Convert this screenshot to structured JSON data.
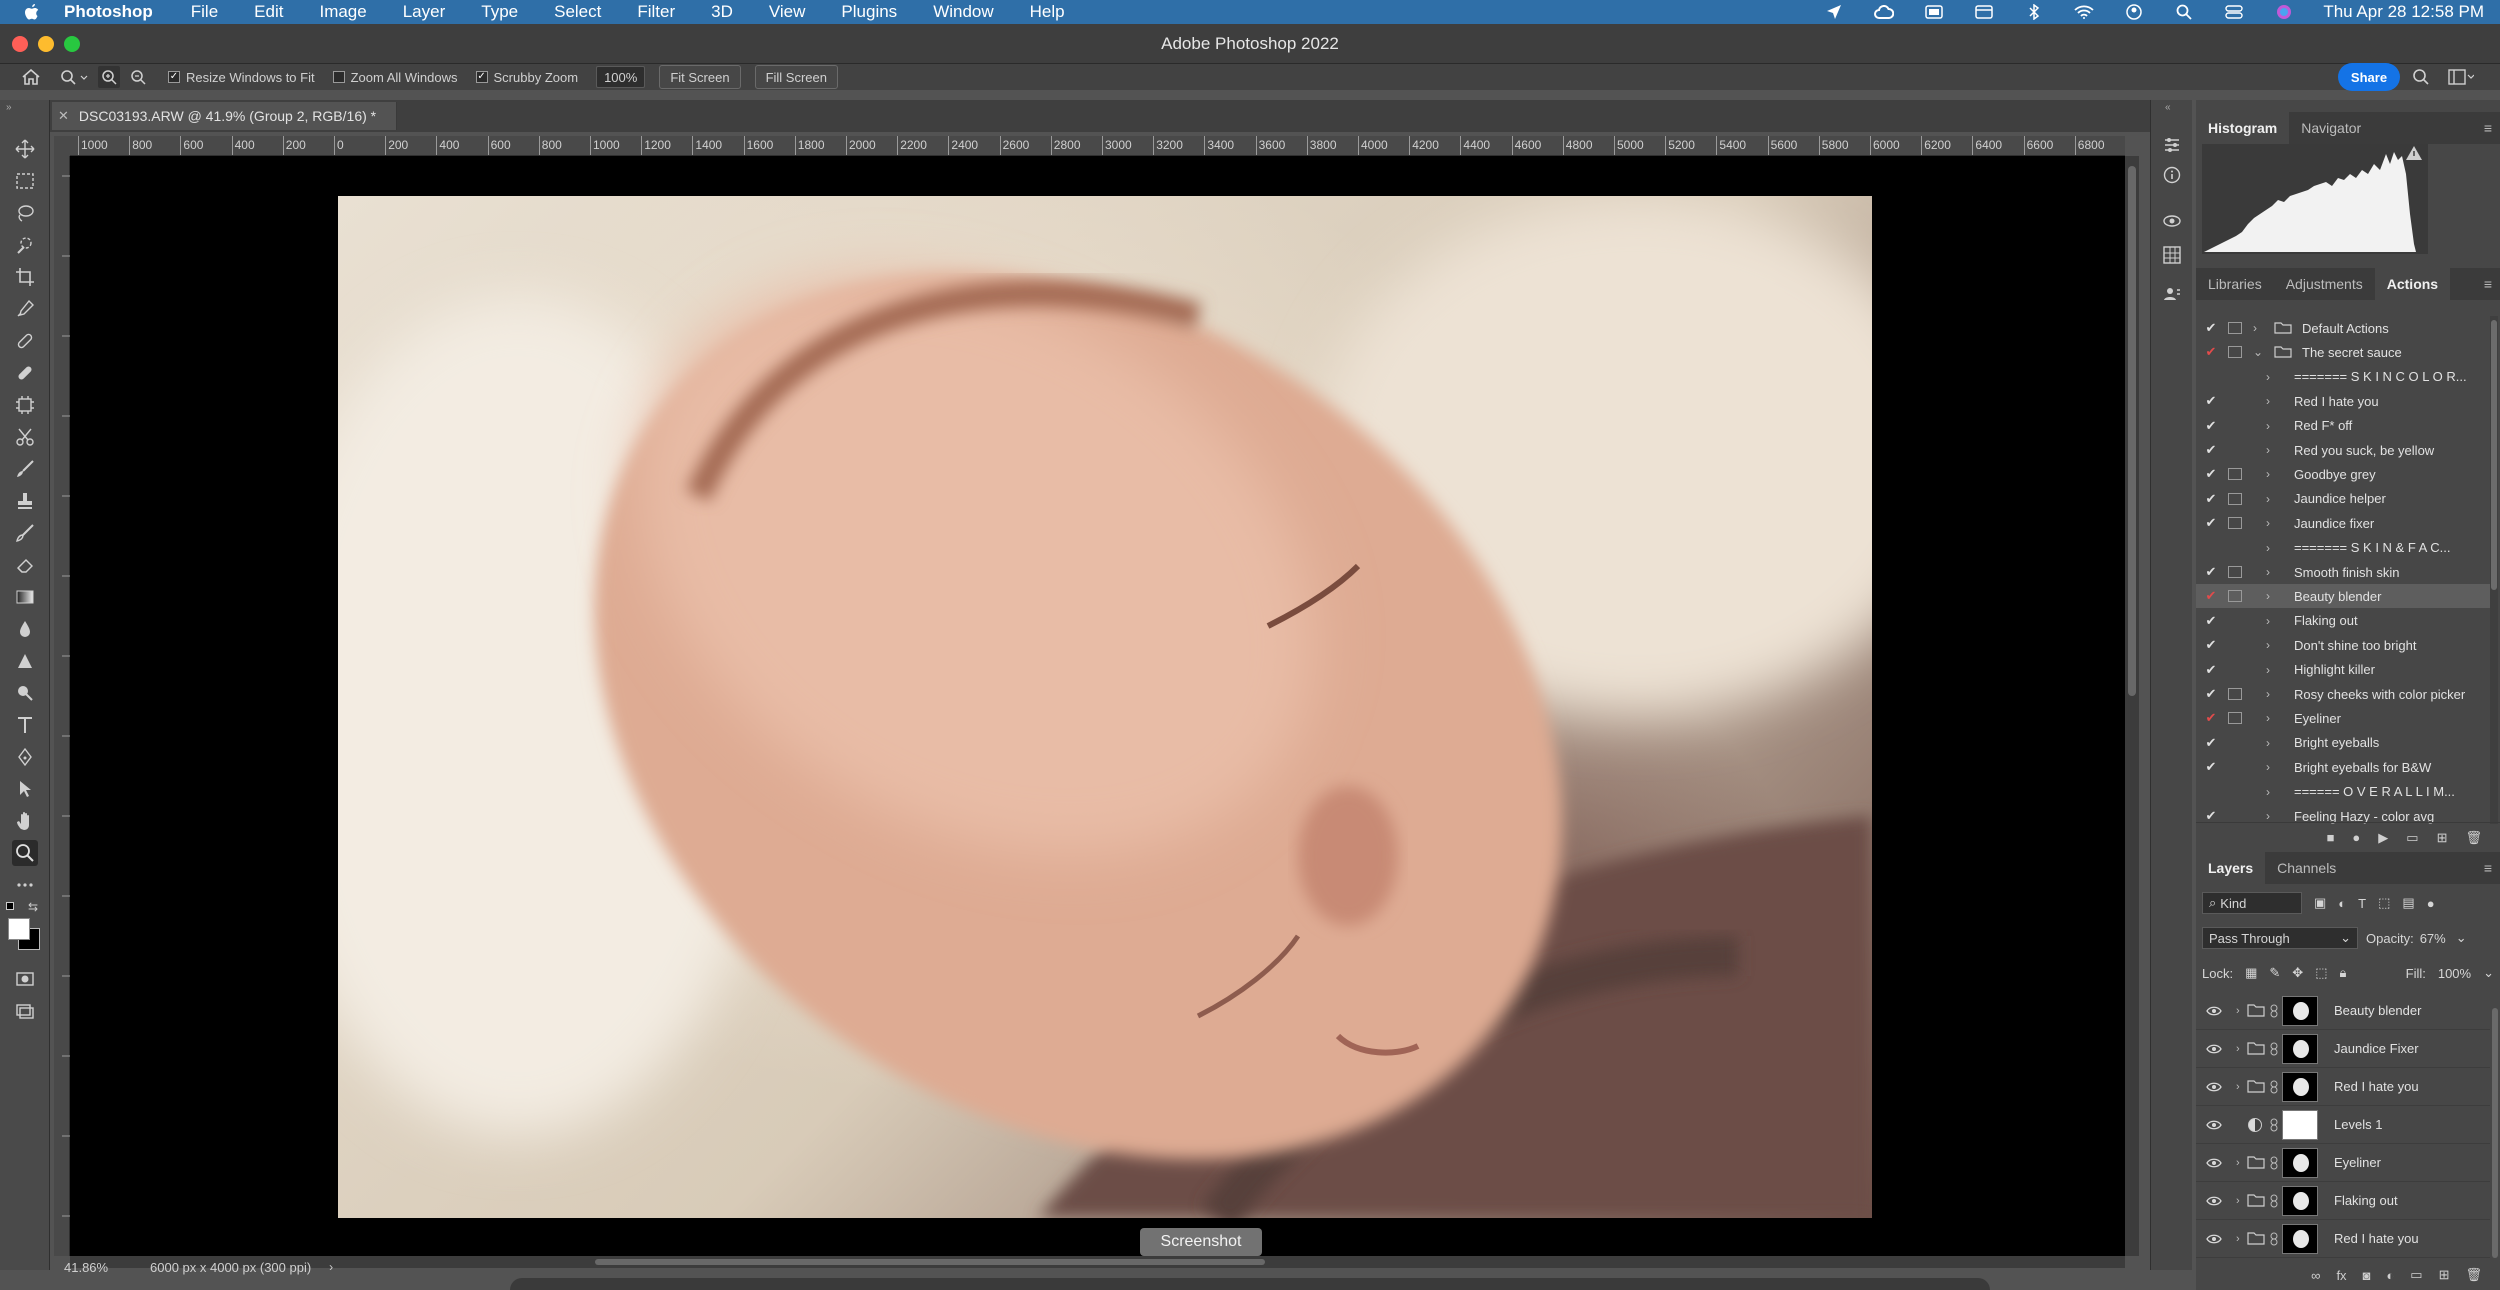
{
  "menubar": {
    "app": "Photoshop",
    "items": [
      "File",
      "Edit",
      "Image",
      "Layer",
      "Type",
      "Select",
      "Filter",
      "3D",
      "View",
      "Plugins",
      "Window",
      "Help"
    ],
    "clock": "Thu Apr 28  12:58 PM"
  },
  "window": {
    "title": "Adobe Photoshop 2022"
  },
  "options": {
    "resize_windows": "Resize Windows to Fit",
    "zoom_all": "Zoom All Windows",
    "scrubby": "Scrubby Zoom",
    "zoom_value": "100%",
    "fit_screen": "Fit Screen",
    "fill_screen": "Fill Screen",
    "share": "Share"
  },
  "document": {
    "tab": "DSC03193.ARW @ 41.9% (Group 2, RGB/16) *",
    "zoom": "41.86%",
    "info": "6000 px x 4000 px (300 ppi)"
  },
  "ruler": {
    "labels": [
      "1000",
      "800",
      "600",
      "400",
      "200",
      "0",
      "200",
      "400",
      "600",
      "800",
      "1000",
      "1200",
      "1400",
      "1600",
      "1800",
      "2000",
      "2200",
      "2400",
      "2600",
      "2800",
      "3000",
      "3200",
      "3400",
      "3600",
      "3800",
      "4000",
      "4200",
      "4400",
      "4600",
      "4800",
      "5000",
      "5200",
      "5400",
      "5600",
      "5800",
      "6000",
      "6200",
      "6400",
      "6600",
      "6800"
    ]
  },
  "tooltip": "Screenshot",
  "panels": {
    "top_tabs": [
      "Histogram",
      "Navigator"
    ],
    "mid_tabs": [
      "Libraries",
      "Adjustments",
      "Actions"
    ],
    "layer_tabs": [
      "Layers",
      "Channels"
    ]
  },
  "actions": [
    {
      "label": "Default Actions",
      "check": "✔",
      "red": false,
      "dialog": true,
      "twisty": "›",
      "folder": true
    },
    {
      "label": "The secret sauce",
      "check": "✔",
      "red": true,
      "dialog": true,
      "twisty": "⌄",
      "folder": true
    },
    {
      "label": "======= S K I N  C O L O R...",
      "check": "",
      "red": false,
      "dialog": false,
      "twisty": "›",
      "folder": false
    },
    {
      "label": "Red I hate you",
      "check": "✔",
      "red": false,
      "dialog": false,
      "twisty": "›",
      "folder": false
    },
    {
      "label": "Red F* off",
      "check": "✔",
      "red": false,
      "dialog": false,
      "twisty": "›",
      "folder": false
    },
    {
      "label": "Red you suck, be yellow",
      "check": "✔",
      "red": false,
      "dialog": false,
      "twisty": "›",
      "folder": false
    },
    {
      "label": "Goodbye grey",
      "check": "✔",
      "red": false,
      "dialog": true,
      "twisty": "›",
      "folder": false
    },
    {
      "label": "Jaundice helper",
      "check": "✔",
      "red": false,
      "dialog": true,
      "twisty": "›",
      "folder": false
    },
    {
      "label": "Jaundice fixer",
      "check": "✔",
      "red": false,
      "dialog": true,
      "twisty": "›",
      "folder": false
    },
    {
      "label": "======= S K I N  &  F A C...",
      "check": "",
      "red": false,
      "dialog": false,
      "twisty": "›",
      "folder": false
    },
    {
      "label": "Smooth finish skin",
      "check": "✔",
      "red": false,
      "dialog": true,
      "twisty": "›",
      "folder": false
    },
    {
      "label": "Beauty blender",
      "check": "✔",
      "red": true,
      "dialog": true,
      "twisty": "›",
      "folder": false,
      "selected": true
    },
    {
      "label": "Flaking out",
      "check": "✔",
      "red": false,
      "dialog": false,
      "twisty": "›",
      "folder": false
    },
    {
      "label": "Don't shine too bright",
      "check": "✔",
      "red": false,
      "dialog": false,
      "twisty": "›",
      "folder": false
    },
    {
      "label": "Highlight killer",
      "check": "✔",
      "red": false,
      "dialog": false,
      "twisty": "›",
      "folder": false
    },
    {
      "label": "Rosy cheeks with color picker",
      "check": "✔",
      "red": false,
      "dialog": true,
      "twisty": "›",
      "folder": false
    },
    {
      "label": "Eyeliner",
      "check": "✔",
      "red": true,
      "dialog": true,
      "twisty": "›",
      "folder": false
    },
    {
      "label": "Bright eyeballs",
      "check": "✔",
      "red": false,
      "dialog": false,
      "twisty": "›",
      "folder": false
    },
    {
      "label": "Bright eyeballs for B&W",
      "check": "✔",
      "red": false,
      "dialog": false,
      "twisty": "›",
      "folder": false
    },
    {
      "label": "====== O V E R A L L  I M...",
      "check": "",
      "red": false,
      "dialog": false,
      "twisty": "›",
      "folder": false
    },
    {
      "label": "Feeling Hazy - color avg",
      "check": "✔",
      "red": false,
      "dialog": false,
      "twisty": "›",
      "folder": false
    }
  ],
  "layers_controls": {
    "kind": "Kind",
    "blend_mode": "Pass Through",
    "opacity_label": "Opacity:",
    "opacity_value": "67%",
    "lock_label": "Lock:",
    "fill_label": "Fill:",
    "fill_value": "100%"
  },
  "layers": [
    {
      "name": "Beauty blender",
      "type": "group"
    },
    {
      "name": "Jaundice Fixer",
      "type": "group"
    },
    {
      "name": "Red I hate you",
      "type": "group"
    },
    {
      "name": "Levels 1",
      "type": "adjustment"
    },
    {
      "name": "Eyeliner",
      "type": "group"
    },
    {
      "name": "Flaking out",
      "type": "group"
    },
    {
      "name": "Red I hate you",
      "type": "group"
    }
  ],
  "colors": {
    "accent": "#1473e6",
    "menubar": "#2f6fa8",
    "panel": "#474747",
    "red_check": "#e24b4b"
  }
}
